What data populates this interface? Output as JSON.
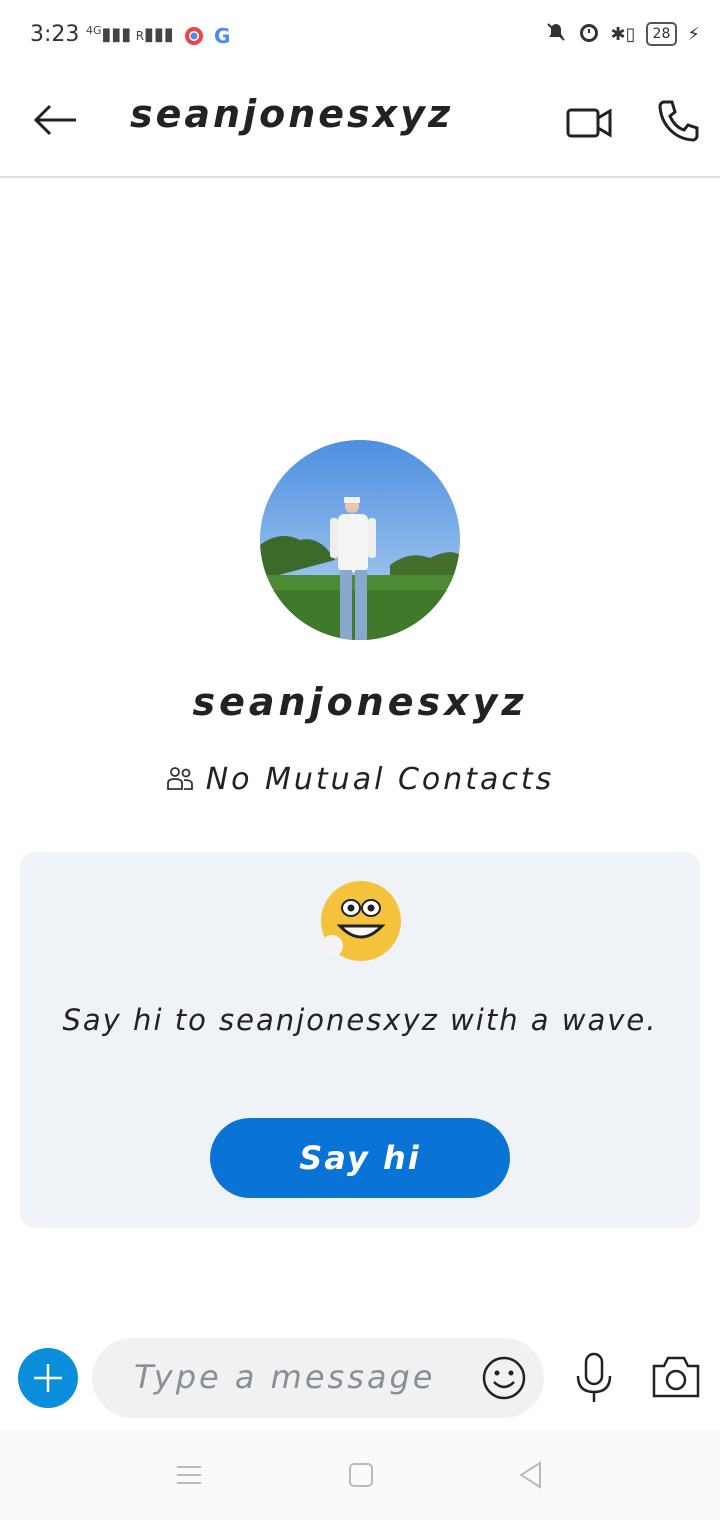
{
  "status_bar": {
    "time": "3:23",
    "network": "4G",
    "roaming": "R",
    "battery": "28"
  },
  "header": {
    "title": "seanjonesxyz"
  },
  "profile": {
    "name": "seanjonesxyz",
    "mutual_text": "No Mutual Contacts"
  },
  "card": {
    "message": "Say hi to seanjonesxyz with a wave.",
    "button_label": "Say hi"
  },
  "composer": {
    "placeholder": "Type a message"
  },
  "colors": {
    "accent": "#0a74d6",
    "card_bg": "#eff2f7"
  }
}
